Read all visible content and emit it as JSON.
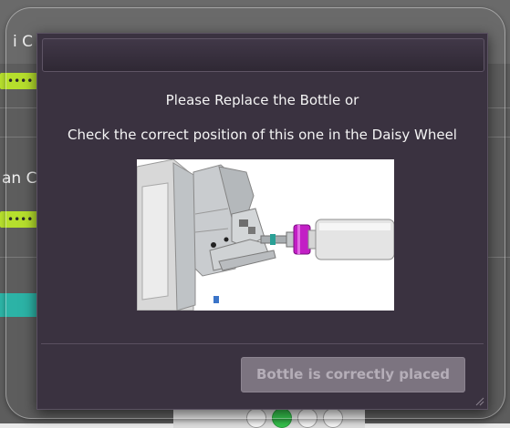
{
  "background": {
    "partial_label_top": "i C",
    "partial_label_mid": "an C",
    "green_indicator_dots": "••••"
  },
  "dialog": {
    "message_line1": "Please Replace the Bottle or",
    "message_line2": "Check the correct position of this one in the Daisy Wheel",
    "confirm_button_label": "Bottle is correctly placed",
    "illustration_icon": "bottle-in-daisy-wheel-illustration"
  },
  "colors": {
    "dialog_bg": "#3a3240",
    "button_bg": "#7c7480",
    "bottle_cap_magenta": "#c21fc5",
    "indicator_green": "#b6df2d",
    "indicator_teal": "#2cb3a6"
  }
}
